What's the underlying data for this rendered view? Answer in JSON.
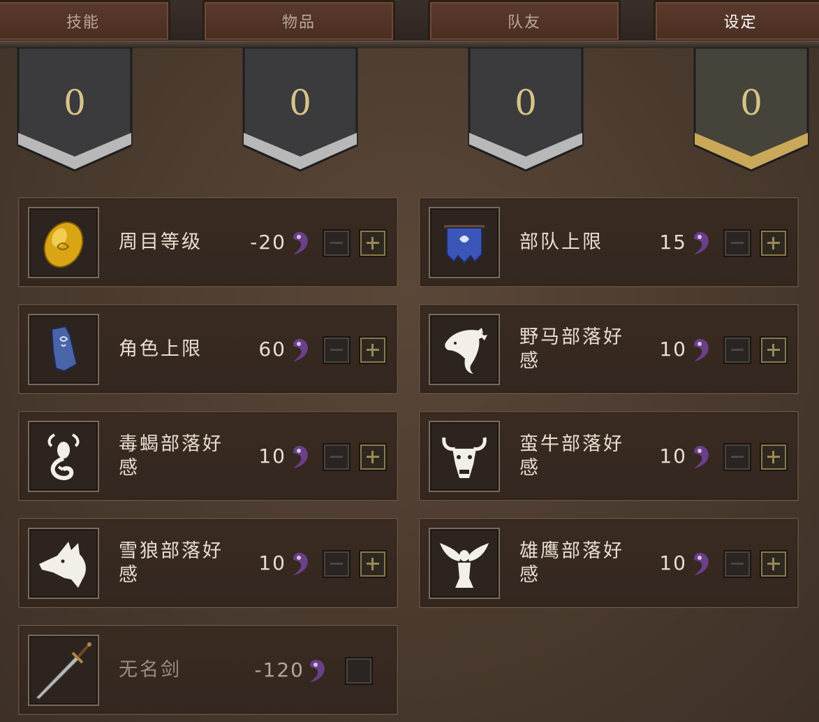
{
  "tabs": [
    {
      "label": "技能",
      "active": false
    },
    {
      "label": "物品",
      "active": false
    },
    {
      "label": "队友",
      "active": false
    },
    {
      "label": "设定",
      "active": true
    }
  ],
  "banners": [
    {
      "value": "0",
      "trim": "silver"
    },
    {
      "value": "0",
      "trim": "silver"
    },
    {
      "value": "0",
      "trim": "silver"
    },
    {
      "value": "0",
      "trim": "gold"
    }
  ],
  "settings": [
    {
      "label": "周目等级",
      "value": "-20",
      "icon": "golden-egg-icon",
      "control": "stepper"
    },
    {
      "label": "部队上限",
      "value": "15",
      "icon": "blue-banner-icon",
      "control": "stepper"
    },
    {
      "label": "角色上限",
      "value": "60",
      "icon": "blue-tabard-icon",
      "control": "stepper"
    },
    {
      "label": "野马部落好感",
      "value": "10",
      "icon": "horse-head-icon",
      "control": "stepper"
    },
    {
      "label": "毒蝎部落好感",
      "value": "10",
      "icon": "scorpion-icon",
      "control": "stepper"
    },
    {
      "label": "蛮牛部落好感",
      "value": "10",
      "icon": "bull-head-icon",
      "control": "stepper"
    },
    {
      "label": "雪狼部落好感",
      "value": "10",
      "icon": "wolf-head-icon",
      "control": "stepper"
    },
    {
      "label": "雄鹰部落好感",
      "value": "10",
      "icon": "eagle-icon",
      "control": "stepper"
    },
    {
      "label": "无名剑",
      "value": "-120",
      "icon": "sword-icon",
      "control": "checkbox",
      "checked": false
    }
  ],
  "colors": {
    "soul": "#6b3f8a",
    "gold_trim": "#c9a85a",
    "silver_trim": "#b5b5b5"
  }
}
